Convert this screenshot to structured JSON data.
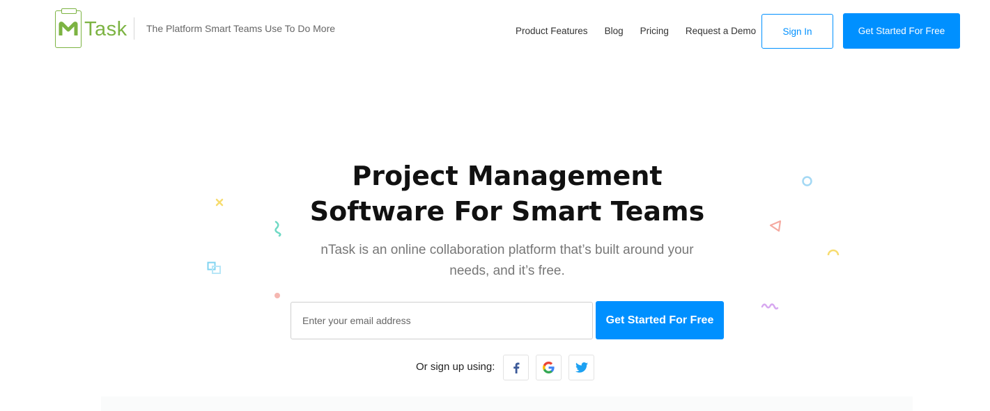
{
  "brand": {
    "name": "Task",
    "tagline": "The Platform Smart Teams Use To Do More",
    "color": "#7cb342"
  },
  "nav": {
    "items": [
      {
        "label": "Product Features"
      },
      {
        "label": "Blog"
      },
      {
        "label": "Pricing"
      },
      {
        "label": "Request a Demo"
      }
    ],
    "signin_label": "Sign In",
    "cta_label": "Get Started For Free"
  },
  "hero": {
    "title_line1": "Project Management",
    "title_line2": "Software For Smart Teams",
    "subtitle_line1": "nTask is an online collaboration platform that’s built around your",
    "subtitle_line2": "needs, and it’s free.",
    "email_placeholder": "Enter your email address",
    "cta_label": "Get Started For Free",
    "signup_label": "Or sign up using:"
  },
  "social": [
    {
      "name": "facebook",
      "icon": "facebook-icon"
    },
    {
      "name": "google",
      "icon": "google-icon"
    },
    {
      "name": "twitter",
      "icon": "twitter-icon"
    }
  ],
  "colors": {
    "accent": "#0090ff",
    "brand_green": "#7cb342"
  }
}
